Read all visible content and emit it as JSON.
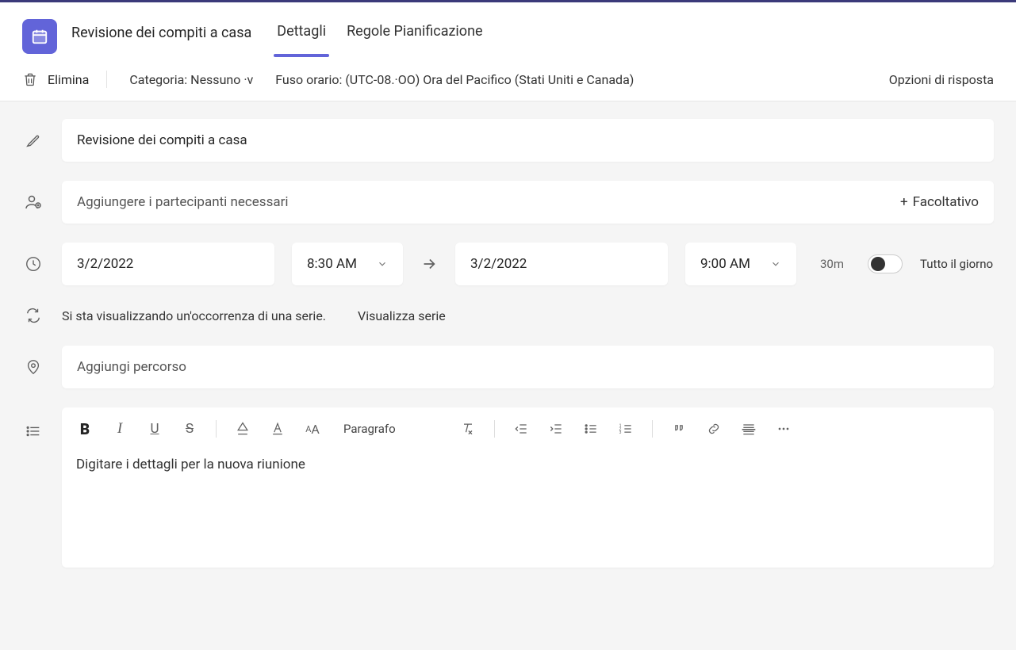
{
  "header": {
    "title": "Revisione dei compiti a casa",
    "tabs": [
      {
        "label": "Dettagli",
        "active": true
      },
      {
        "label": "Regole Pianificazione",
        "active": false
      }
    ]
  },
  "subbar": {
    "delete_label": "Elimina",
    "category": "Categoria: Nessuno ·v",
    "timezone": "Fuso orario: (UTC-08.·OO) Ora del Pacifico (Stati Uniti e Canada)",
    "response_options": "Opzioni di risposta"
  },
  "form": {
    "title_value": "Revisione dei compiti a casa",
    "participants_placeholder": "Aggiungere i partecipanti necessari",
    "optional_label": "Facoltativo",
    "start_date": "3/2/2022",
    "start_time": "8:30 AM",
    "end_date": "3/2/2022",
    "end_time": "9:00 AM",
    "duration": "30m",
    "allday_label": "Tutto il giorno",
    "series_text": "Si sta visualizzando un'occorrenza di una serie.",
    "series_link": "Visualizza serie",
    "location_placeholder": "Aggiungi percorso",
    "editor_placeholder": "Digitare i dettagli per la nuova riunione"
  },
  "toolbar": {
    "paragraph_label": "Paragrafo"
  }
}
